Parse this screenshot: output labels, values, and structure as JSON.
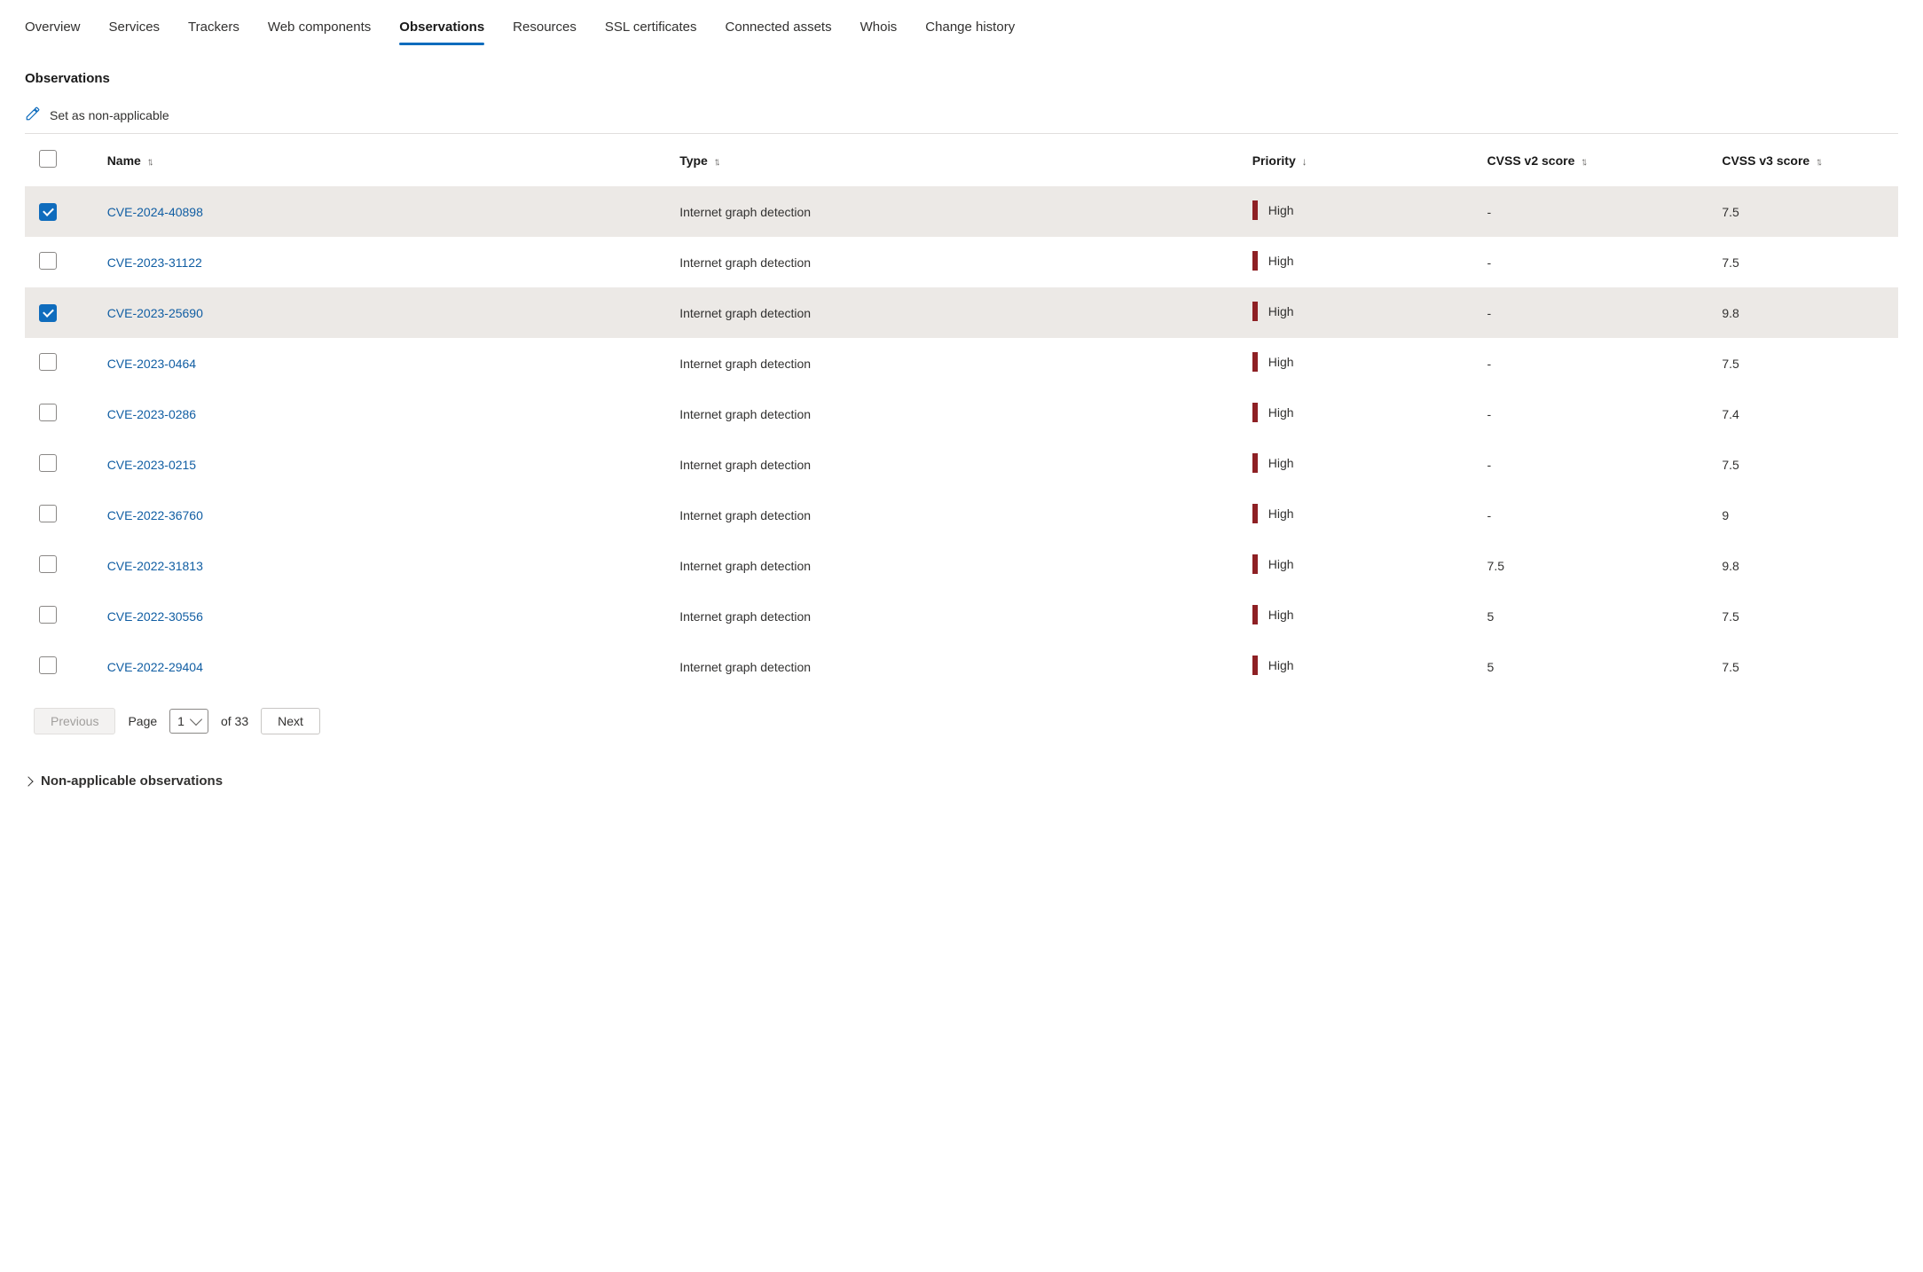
{
  "tabs": [
    {
      "label": "Overview",
      "active": false
    },
    {
      "label": "Services",
      "active": false
    },
    {
      "label": "Trackers",
      "active": false
    },
    {
      "label": "Web components",
      "active": false
    },
    {
      "label": "Observations",
      "active": true
    },
    {
      "label": "Resources",
      "active": false
    },
    {
      "label": "SSL certificates",
      "active": false
    },
    {
      "label": "Connected assets",
      "active": false
    },
    {
      "label": "Whois",
      "active": false
    },
    {
      "label": "Change history",
      "active": false
    }
  ],
  "section_title": "Observations",
  "action": {
    "label": "Set as non-applicable"
  },
  "columns": {
    "name": "Name",
    "type": "Type",
    "priority": "Priority",
    "cvss2": "CVSS v2 score",
    "cvss3": "CVSS v3 score"
  },
  "rows": [
    {
      "selected": true,
      "name": "CVE-2024-40898",
      "type": "Internet graph detection",
      "priority": "High",
      "cvss2": "-",
      "cvss3": "7.5"
    },
    {
      "selected": false,
      "name": "CVE-2023-31122",
      "type": "Internet graph detection",
      "priority": "High",
      "cvss2": "-",
      "cvss3": "7.5"
    },
    {
      "selected": true,
      "name": "CVE-2023-25690",
      "type": "Internet graph detection",
      "priority": "High",
      "cvss2": "-",
      "cvss3": "9.8"
    },
    {
      "selected": false,
      "name": "CVE-2023-0464",
      "type": "Internet graph detection",
      "priority": "High",
      "cvss2": "-",
      "cvss3": "7.5"
    },
    {
      "selected": false,
      "name": "CVE-2023-0286",
      "type": "Internet graph detection",
      "priority": "High",
      "cvss2": "-",
      "cvss3": "7.4"
    },
    {
      "selected": false,
      "name": "CVE-2023-0215",
      "type": "Internet graph detection",
      "priority": "High",
      "cvss2": "-",
      "cvss3": "7.5"
    },
    {
      "selected": false,
      "name": "CVE-2022-36760",
      "type": "Internet graph detection",
      "priority": "High",
      "cvss2": "-",
      "cvss3": "9"
    },
    {
      "selected": false,
      "name": "CVE-2022-31813",
      "type": "Internet graph detection",
      "priority": "High",
      "cvss2": "7.5",
      "cvss3": "9.8"
    },
    {
      "selected": false,
      "name": "CVE-2022-30556",
      "type": "Internet graph detection",
      "priority": "High",
      "cvss2": "5",
      "cvss3": "7.5"
    },
    {
      "selected": false,
      "name": "CVE-2022-29404",
      "type": "Internet graph detection",
      "priority": "High",
      "cvss2": "5",
      "cvss3": "7.5"
    }
  ],
  "pager": {
    "prev": "Previous",
    "page_label": "Page",
    "page_value": "1",
    "of_label": "of 33",
    "next": "Next"
  },
  "collapsed_section": "Non-applicable observations"
}
